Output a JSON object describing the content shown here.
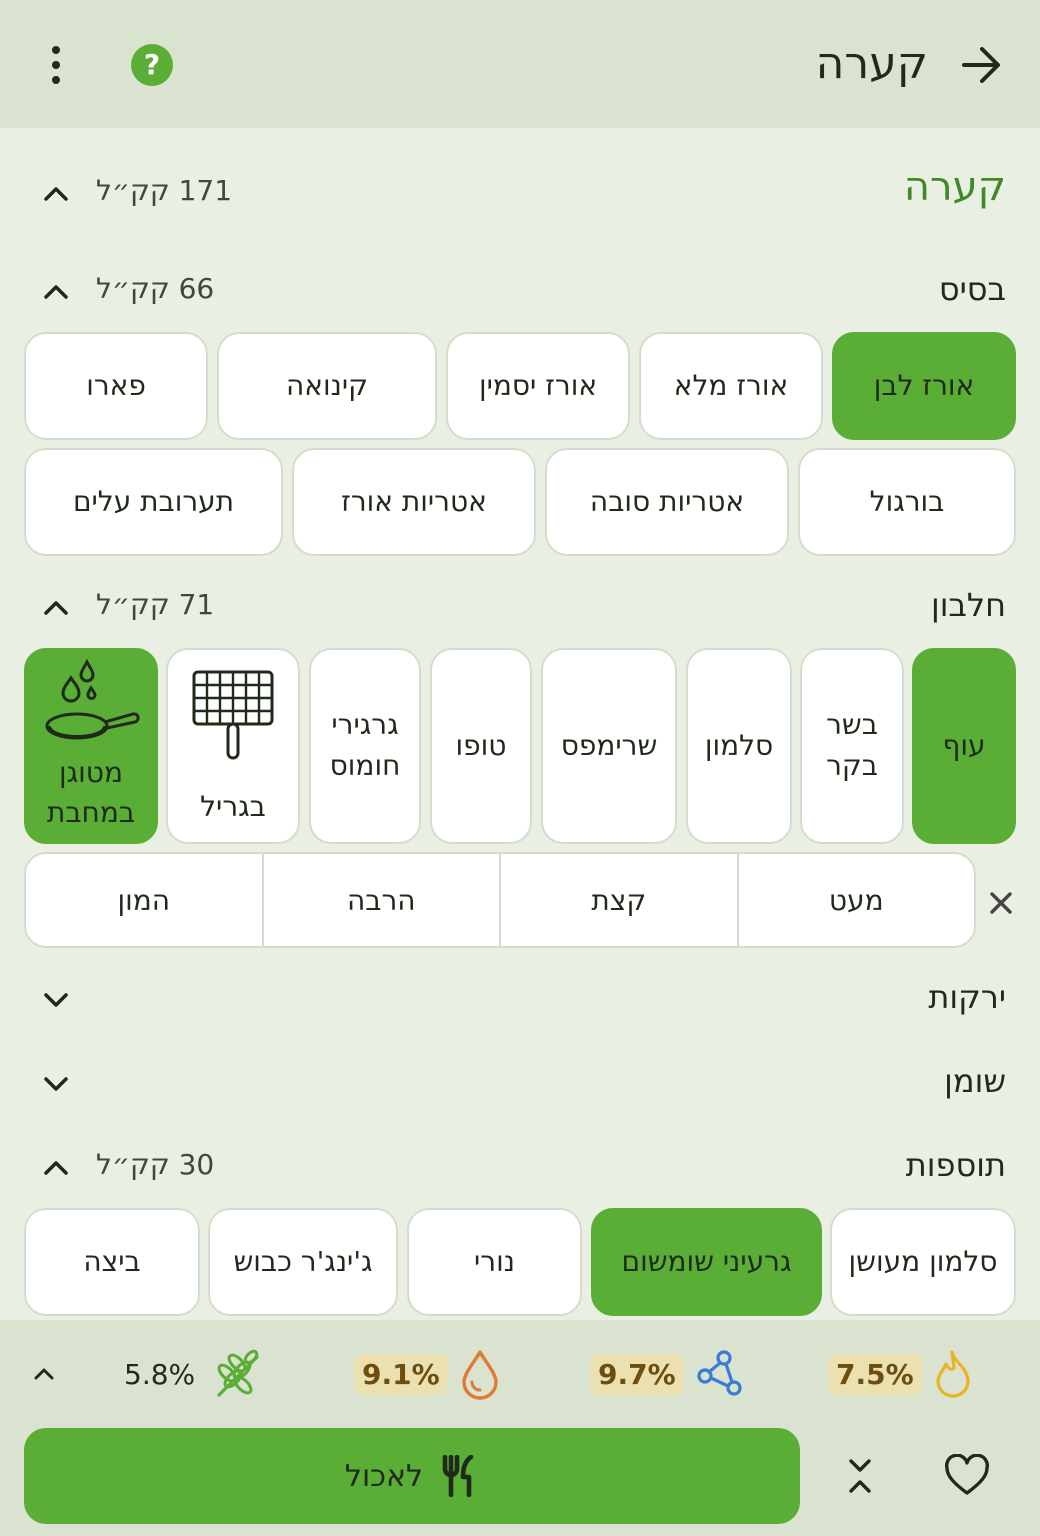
{
  "header": {
    "title": "קערה"
  },
  "bowl": {
    "title": "קערה",
    "kcal": "171 קק״ל"
  },
  "base": {
    "label": "בסיס",
    "kcal": "66 קק״ל",
    "options": [
      "אורז לבן",
      "אורז מלא",
      "אורז יסמין",
      "קינואה",
      "פארו",
      "בורגול",
      "אטריות סובה",
      "אטריות אורז",
      "תערובת עלים"
    ],
    "selected": "אורז לבן"
  },
  "protein": {
    "label": "חלבון",
    "kcal": "71 קק״ל",
    "options": [
      "עוף",
      "בשר בקר",
      "סלמון",
      "שרימפס",
      "טופו",
      "גרגירי חומוס"
    ],
    "selected": "עוף",
    "cooking": {
      "grill": "בגריל",
      "fried": "מטוגן במחבת"
    },
    "cooking_selected": "מטוגן במחבת",
    "amounts": [
      "מעט",
      "קצת",
      "הרבה",
      "המון"
    ]
  },
  "vegetables": {
    "label": "ירקות"
  },
  "fat": {
    "label": "שומן"
  },
  "toppings": {
    "label": "תוספות",
    "kcal": "30 קק״ל",
    "options": [
      "סלמון מעושן",
      "גרעיני שומשום",
      "נורי",
      "ג'ינג'ר כבוש",
      "ביצה"
    ],
    "selected": "גרעיני שומשום"
  },
  "stats": {
    "carbs": "5.8%",
    "fat": "9.1%",
    "protein": "9.7%",
    "calories": "7.5%"
  },
  "footer": {
    "eat_label": "לאכול"
  },
  "colors": {
    "accent": "#5aad35",
    "bar": "#d9e3cf",
    "background": "#eaefe3"
  }
}
